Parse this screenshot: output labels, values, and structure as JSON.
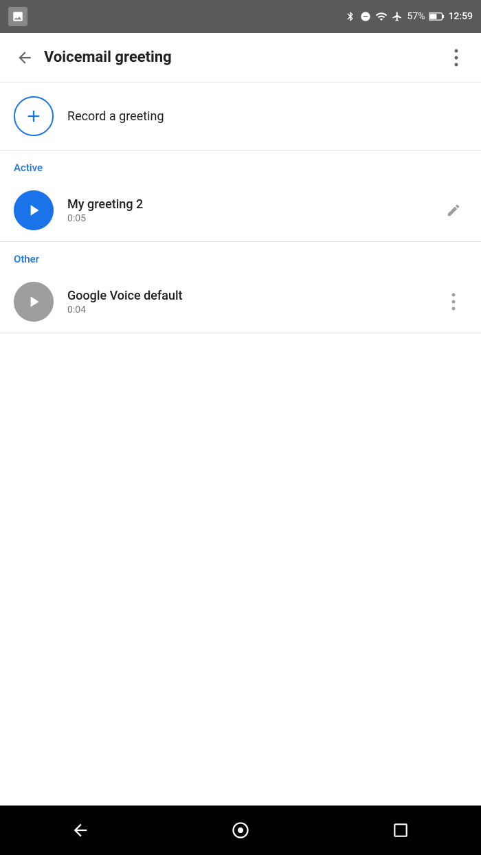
{
  "status_bar": {
    "time": "12:59",
    "battery_percent": "57%"
  },
  "app_bar": {
    "title": "Voicemail greeting"
  },
  "record_row": {
    "label": "Record a greeting"
  },
  "sections": [
    {
      "header": "Active",
      "items": [
        {
          "name": "My greeting 2",
          "duration": "0:05",
          "action": "edit"
        }
      ]
    },
    {
      "header": "Other",
      "items": [
        {
          "name": "Google Voice default",
          "duration": "0:04",
          "action": "more"
        }
      ]
    }
  ]
}
